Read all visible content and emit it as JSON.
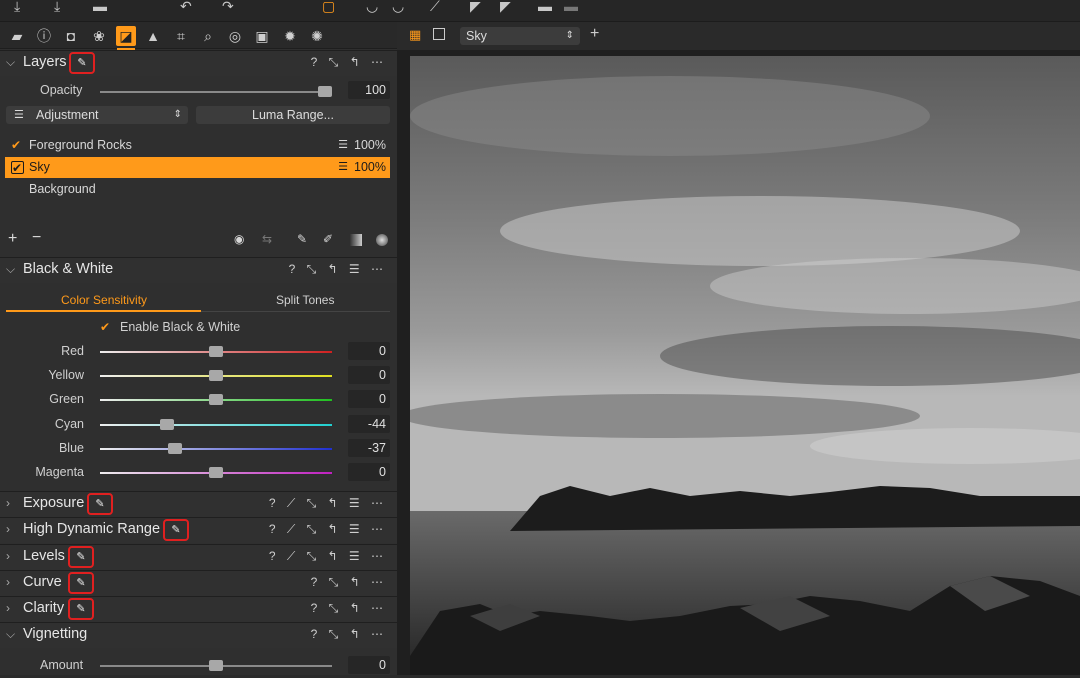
{
  "layers": {
    "title": "Layers",
    "opacity_label": "Opacity",
    "opacity_value": "100",
    "adjustment_label": "Adjustment",
    "luma_label": "Luma Range...",
    "items": [
      {
        "name": "Foreground Rocks",
        "checked": true,
        "opacity": "100%"
      },
      {
        "name": "Sky",
        "checked": true,
        "opacity": "100%",
        "selected": true
      },
      {
        "name": "Background",
        "checked": false,
        "opacity": ""
      }
    ]
  },
  "bw": {
    "title": "Black & White",
    "tab_active": "Color Sensitivity",
    "tab_other": "Split Tones",
    "enable_label": "Enable Black & White",
    "sliders": [
      {
        "label": "Red",
        "value": "0"
      },
      {
        "label": "Yellow",
        "value": "0"
      },
      {
        "label": "Green",
        "value": "0"
      },
      {
        "label": "Cyan",
        "value": "-44"
      },
      {
        "label": "Blue",
        "value": "-37"
      },
      {
        "label": "Magenta",
        "value": "0"
      }
    ]
  },
  "sections": [
    {
      "title": "Exposure"
    },
    {
      "title": "High Dynamic Range"
    },
    {
      "title": "Levels"
    },
    {
      "title": "Curve"
    },
    {
      "title": "Clarity"
    },
    {
      "title": "Vignetting"
    }
  ],
  "vignetting": {
    "amount_label": "Amount",
    "amount_value": "0"
  },
  "viewer": {
    "layer_select": "Sky"
  },
  "colors": {
    "accent": "#ff9a1a",
    "highlight_red": "#e02020"
  }
}
